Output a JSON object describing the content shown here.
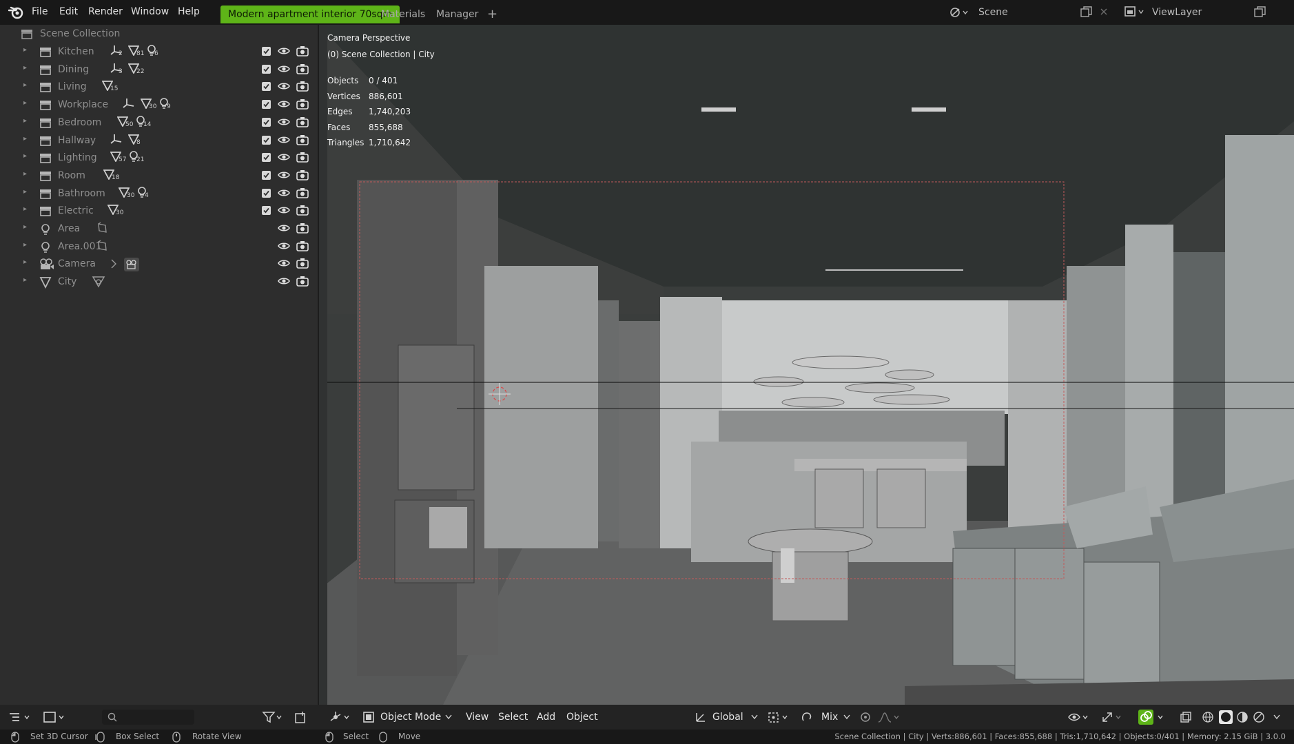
{
  "menu": [
    "File",
    "Edit",
    "Render",
    "Window",
    "Help"
  ],
  "workspaces": [
    "Modern apartment interior 70sqm",
    "Materials",
    "Manager"
  ],
  "add_workspace": "+",
  "scene": "Scene",
  "view_layer": "ViewLayer",
  "outliner": {
    "root": "Scene Collection",
    "items": [
      {
        "label": "Kitchen",
        "badges": [
          "2",
          "81",
          "6"
        ]
      },
      {
        "label": "Dining",
        "badges": [
          "3",
          "22"
        ]
      },
      {
        "label": "Living",
        "badges": [
          "15"
        ]
      },
      {
        "label": "Workplace",
        "badges": [
          "",
          "30",
          "9"
        ]
      },
      {
        "label": "Bedroom",
        "badges": [
          "50",
          "14"
        ]
      },
      {
        "label": "Hallway",
        "badges": [
          "",
          "8"
        ]
      },
      {
        "label": "Lighting",
        "badges": [
          "57",
          "21"
        ]
      },
      {
        "label": "Room",
        "badges": [
          "18"
        ]
      },
      {
        "label": "Bathroom",
        "badges": [
          "30",
          "4"
        ]
      },
      {
        "label": "Electric",
        "badges": [
          "30"
        ]
      },
      {
        "label": "Area",
        "badges": []
      },
      {
        "label": "Area.001",
        "badges": []
      },
      {
        "label": "Camera",
        "badges": []
      },
      {
        "label": "City",
        "badges": []
      }
    ]
  },
  "viewport": {
    "title": "Camera Perspective",
    "subtitle": "(0) Scene Collection | City",
    "stats": [
      {
        "label": "Objects",
        "value": "0 / 401"
      },
      {
        "label": "Vertices",
        "value": "886,601"
      },
      {
        "label": "Edges",
        "value": "1,740,203"
      },
      {
        "label": "Faces",
        "value": "855,688"
      },
      {
        "label": "Triangles",
        "value": "1,710,642"
      }
    ]
  },
  "header": {
    "mode": "Object Mode",
    "menus": [
      "View",
      "Select",
      "Add",
      "Object"
    ],
    "transform": "Global",
    "snap": "Mix"
  },
  "status": {
    "hints": [
      "Set 3D Cursor",
      "Box Select",
      "Rotate View",
      "Select",
      "Move"
    ],
    "info": "Scene Collection | City | Verts:886,601 | Faces:855,688 | Tris:1,710,642 | Objects:0/401 | Memory: 2.15 GiB | 3.0.0"
  },
  "colors": {
    "accent": "#5eb418",
    "panel": "#2d2d2d",
    "viewport": "#3a3d3c"
  }
}
